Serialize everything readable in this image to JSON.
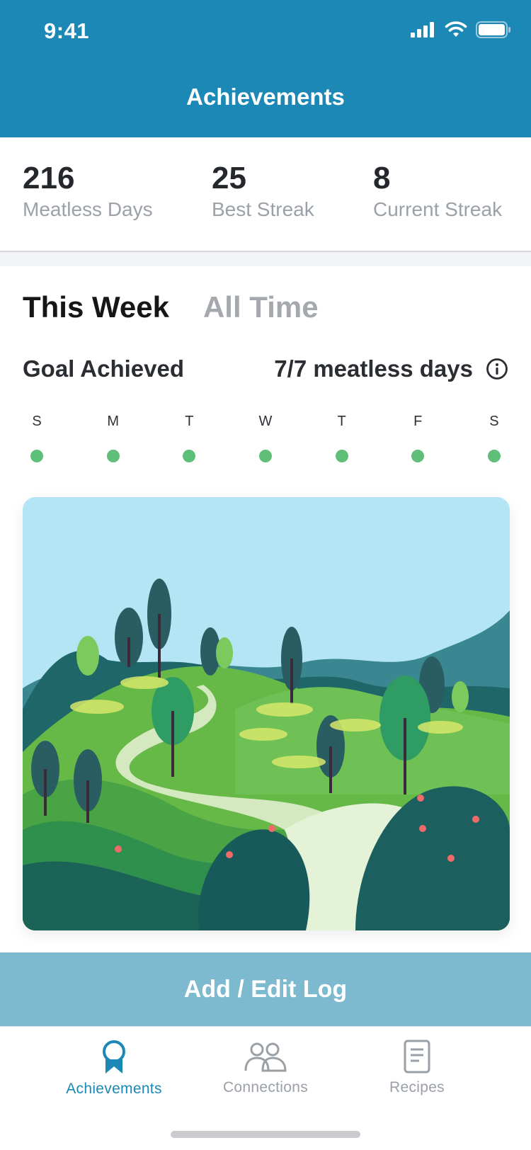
{
  "status_bar": {
    "time": "9:41"
  },
  "header": {
    "title": "Achievements"
  },
  "stats": [
    {
      "value": "216",
      "label": "Meatless Days"
    },
    {
      "value": "25",
      "label": "Best Streak"
    },
    {
      "value": "8",
      "label": "Current Streak"
    }
  ],
  "tabs": [
    {
      "label": "This Week",
      "active": true
    },
    {
      "label": "All Time",
      "active": false
    }
  ],
  "goal": {
    "label": "Goal Achieved",
    "value": "7/7 meatless days"
  },
  "week": {
    "days": [
      "S",
      "M",
      "T",
      "W",
      "T",
      "F",
      "S"
    ],
    "completed": [
      true,
      true,
      true,
      true,
      true,
      true,
      true
    ]
  },
  "action_button": {
    "label": "Add / Edit Log"
  },
  "tabbar": {
    "items": [
      {
        "label": "Achievements",
        "icon": "ribbon-icon",
        "active": true
      },
      {
        "label": "Connections",
        "icon": "people-icon",
        "active": false
      },
      {
        "label": "Recipes",
        "icon": "document-icon",
        "active": false
      }
    ]
  },
  "colors": {
    "header": "#1b88b6",
    "button": "#7db9cf",
    "dot": "#5fbf78",
    "tab_active": "#1b88b6",
    "tab_inactive": "#9aa0a6"
  }
}
